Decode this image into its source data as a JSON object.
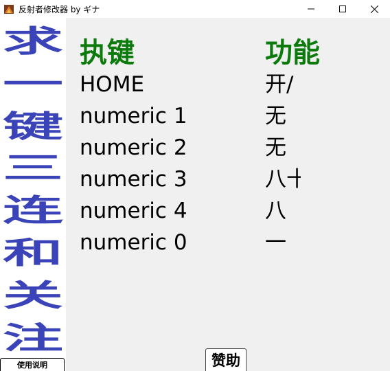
{
  "window": {
    "title": "反射者修改器 by ギナ",
    "app_icon": "reflector-app-icon",
    "controls": [
      "minimize-icon",
      "maximize-icon",
      "close-icon"
    ]
  },
  "sidebar": {
    "banner_chars": [
      "求",
      "一",
      "键",
      "三",
      "连",
      "和",
      "关",
      "注"
    ],
    "banner_color": "#3b43b8",
    "help_button": "使用说明"
  },
  "main": {
    "hotkey_header": "执键",
    "function_header": "功能",
    "header_color": "#0d7a0d",
    "hotkeys": [
      "HOME",
      "numeric 1",
      "numeric 2",
      "numeric 3",
      "numeric 4",
      "numeric 0"
    ],
    "functions_visible": [
      "开/",
      "无",
      "无",
      "八十",
      "八",
      "一"
    ],
    "donate_button": "赞助"
  }
}
